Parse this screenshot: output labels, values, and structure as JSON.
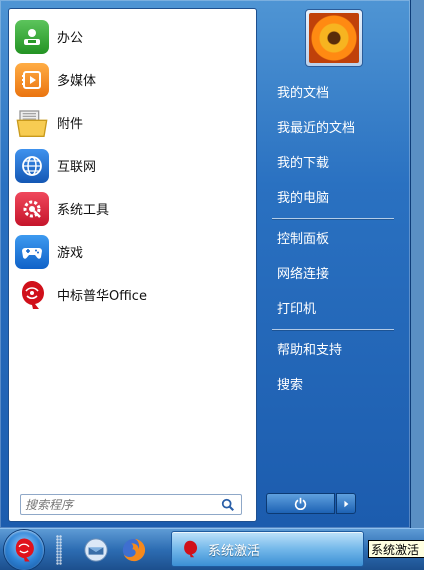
{
  "colors": {
    "menu_blue": "#2a71c1",
    "office_red": "#d0101a"
  },
  "programs": [
    {
      "label": "办公",
      "icon": "office-suite-icon",
      "color": "#3aa83a"
    },
    {
      "label": "多媒体",
      "icon": "multimedia-icon",
      "color": "#f28a1c"
    },
    {
      "label": "附件",
      "icon": "accessories-folder-icon",
      "color": "#f6c84a"
    },
    {
      "label": "互联网",
      "icon": "globe-icon",
      "color": "#1e6fd1"
    },
    {
      "label": "系统工具",
      "icon": "system-tools-gear-icon",
      "color": "#d9253a"
    },
    {
      "label": "游戏",
      "icon": "gamepad-icon",
      "color": "#1a7de0"
    },
    {
      "label": "中标普华Office",
      "icon": "cs2c-office-logo-icon",
      "color": "#d0101a"
    }
  ],
  "search": {
    "placeholder": "搜索程序"
  },
  "places_group1": [
    "我的文档",
    "我最近的文档",
    "我的下载",
    "我的电脑"
  ],
  "places_group2": [
    "控制面板",
    "网络连接",
    "打印机"
  ],
  "places_group3": [
    "帮助和支持",
    "搜索"
  ],
  "taskbar": {
    "active_window_label": "系统激活",
    "tooltip": "系统激活"
  }
}
